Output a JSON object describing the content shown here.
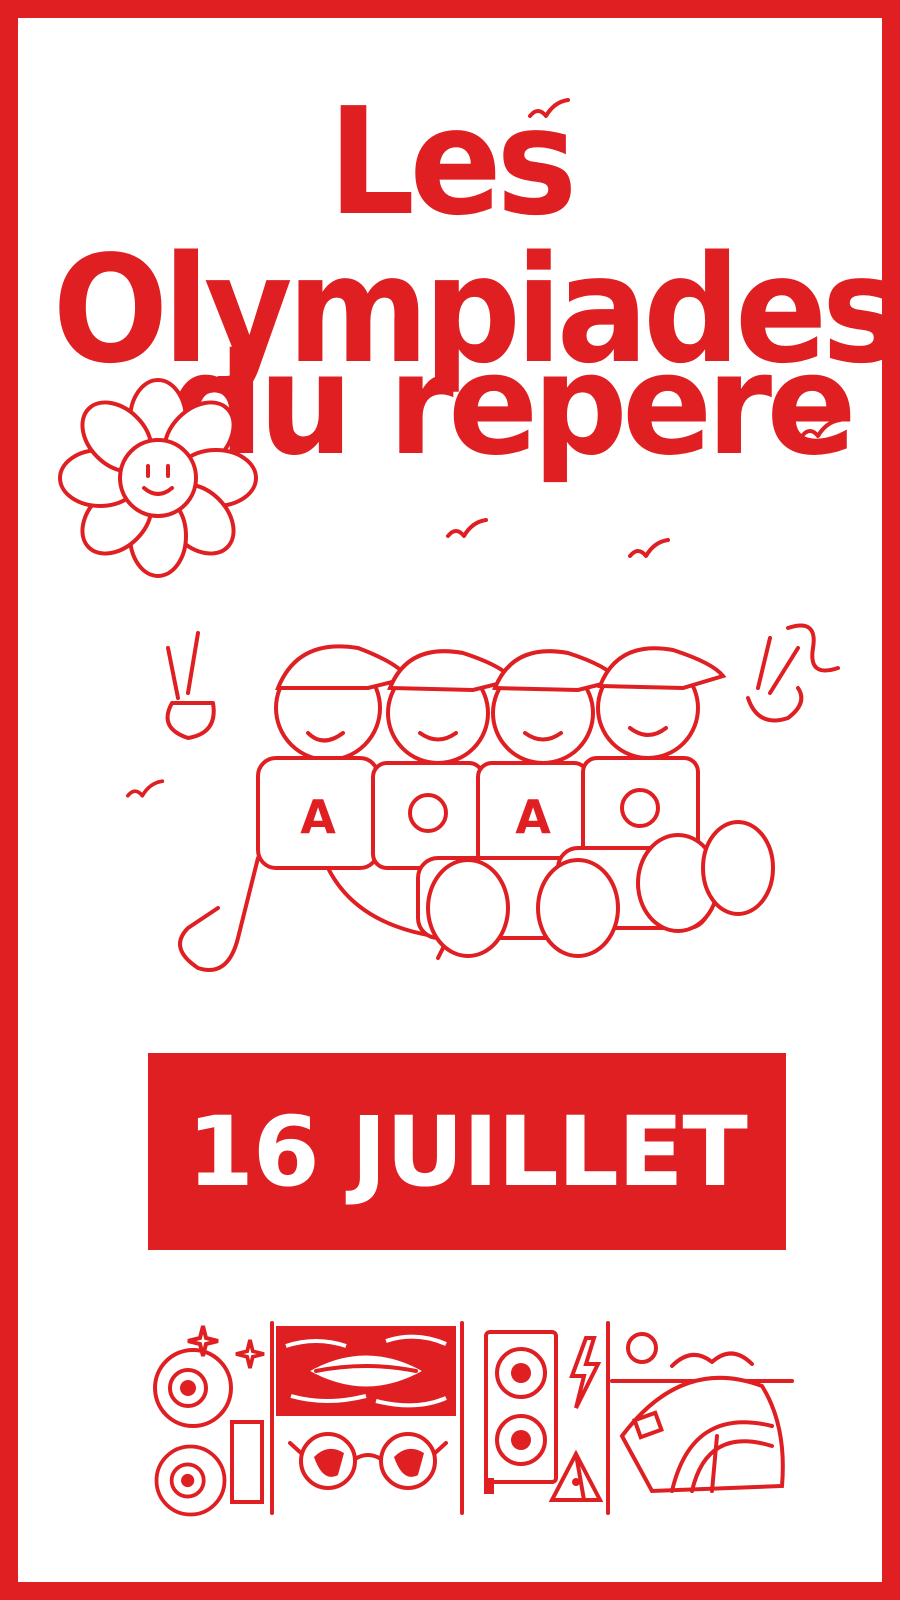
{
  "poster": {
    "title_line_1": "Les Olympiades",
    "title_line_2": "du repere",
    "date": "16 JUILLET",
    "shirt_letter": "A",
    "colors": {
      "accent": "#df1f22",
      "background": "#ffffff"
    }
  },
  "icons": [
    "flower-icon",
    "bird-icon",
    "kids-marching-illustration",
    "eyeball-icon",
    "lips-icon",
    "sunglasses-icon",
    "speaker-icon",
    "lightning-icon",
    "pyramid-icon",
    "dome-tent-icon"
  ]
}
